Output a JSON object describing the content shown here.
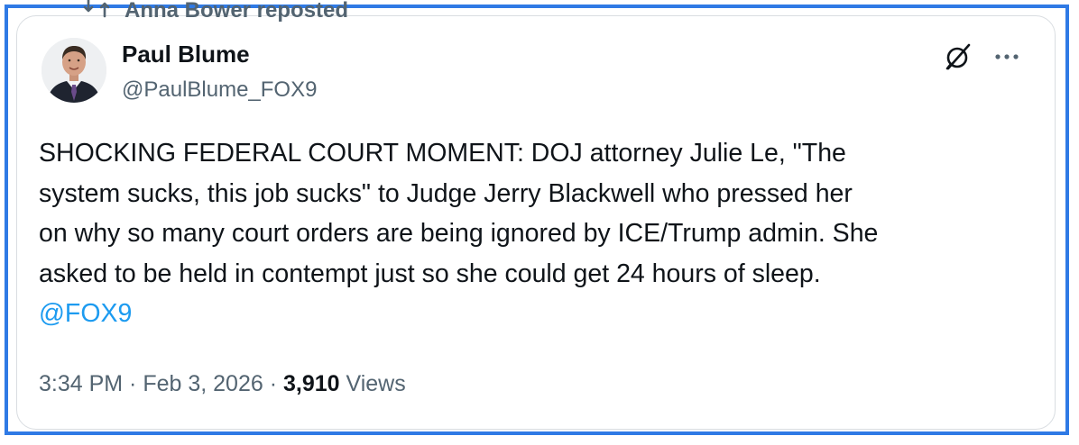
{
  "repost": {
    "icon": "repost-icon",
    "text": "Anna Bower reposted"
  },
  "author": {
    "display_name": "Paul Blume",
    "handle": "@PaulBlume_FOX9",
    "avatar_icon": "avatar"
  },
  "actions": {
    "grok_icon": "grok-icon",
    "more_icon": "more-icon"
  },
  "tweet": {
    "lines": [
      "SHOCKING FEDERAL COURT MOMENT: DOJ attorney Julie Le, \"The",
      "system sucks, this job sucks\" to Judge Jerry Blackwell who pressed her",
      "on why so many court orders are being ignored by ICE/Trump admin. She",
      "asked to be held in contempt just so she could get 24 hours of sleep."
    ],
    "mention": "@FOX9"
  },
  "meta": {
    "time": "3:34 PM",
    "separator1": " · ",
    "date": "Feb 3, 2026",
    "separator2": " · ",
    "views_count": "3,910",
    "views_label": " Views"
  },
  "colors": {
    "frame_border": "#2f7ae5",
    "link": "#1d9bf0",
    "text_primary": "#0f1419",
    "text_secondary": "#536471"
  }
}
